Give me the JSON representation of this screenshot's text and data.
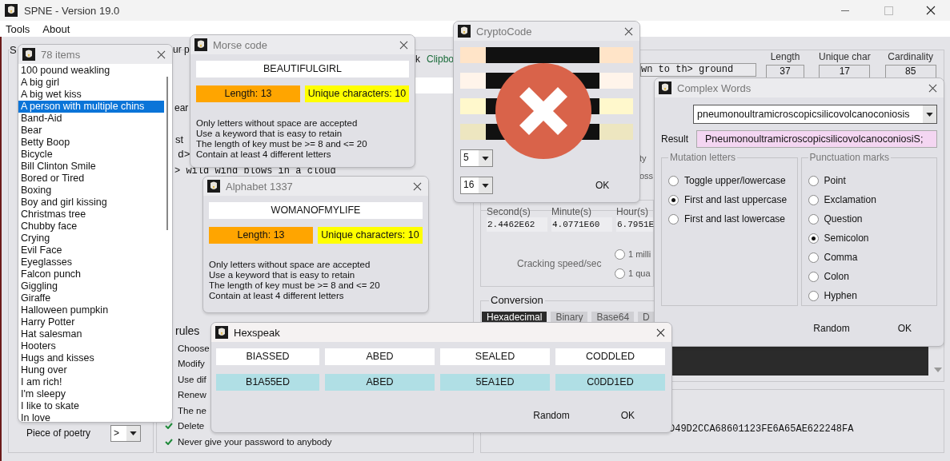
{
  "main_window": {
    "title": "SPNE - Version 19.0",
    "menu": [
      "Tools",
      "About"
    ],
    "password_group": {
      "label": "S",
      "heading_fragment": "ur p",
      "link_fragment": "k",
      "clipboard_link": "Clipbo",
      "button_fragment": "ear",
      "list_label": "st",
      "line_1": "d>",
      "line_2": "> wild wind blows in a cloud"
    },
    "phrase_field": "wn to th> ground",
    "stats": [
      {
        "label": "Length",
        "value": "37"
      },
      {
        "label": "Unique char",
        "value": "17"
      },
      {
        "label": "Cardinality",
        "value": "85"
      }
    ],
    "strength_fragments": [
      "ty",
      "oss"
    ],
    "times": [
      {
        "label": "Second(s)",
        "value": "2.4462E62"
      },
      {
        "label": "Minute(s)",
        "value": "4.0771E60"
      },
      {
        "label": "Hour(s)",
        "value": "6.7951E"
      }
    ],
    "cracking": {
      "label": "Cracking speed/sec",
      "options": [
        {
          "label": "1 milli",
          "selected": false
        },
        {
          "label": "1 qua",
          "selected": false
        }
      ]
    },
    "conversion": {
      "title": "Conversion",
      "tabs": [
        {
          "label": "Hexadecimal",
          "selected": true
        },
        {
          "label": "Binary",
          "selected": false
        },
        {
          "label": "Base64",
          "selected": false
        },
        {
          "label": "D",
          "selected": false
        }
      ],
      "output": "D49D2CCA68601123FE6A65AE622248FA"
    },
    "rules": {
      "title": "rules",
      "items": [
        {
          "text": "Choose"
        },
        {
          "text": "Modify"
        },
        {
          "text": "Use dif"
        },
        {
          "text": "Renew"
        },
        {
          "text": "The ne"
        },
        {
          "text": "Delete",
          "checked": true
        },
        {
          "text": "Never give your password to anybody",
          "checked": true
        }
      ]
    },
    "poetry": {
      "label": "Piece of poetry",
      "value": ">"
    }
  },
  "list_window": {
    "title": "78 items",
    "items": [
      {
        "text": "100 pound weakling",
        "selected": false
      },
      {
        "text": "A big girl",
        "selected": false
      },
      {
        "text": "A big wet kiss",
        "selected": false
      },
      {
        "text": "A person with multiple chins",
        "selected": true
      },
      {
        "text": "Band-Aid",
        "selected": false
      },
      {
        "text": "Bear",
        "selected": false
      },
      {
        "text": "Betty Boop",
        "selected": false
      },
      {
        "text": "Bicycle",
        "selected": false
      },
      {
        "text": "Bill Clinton Smile",
        "selected": false
      },
      {
        "text": "Bored or Tired",
        "selected": false
      },
      {
        "text": "Boxing",
        "selected": false
      },
      {
        "text": "Boy and girl kissing",
        "selected": false
      },
      {
        "text": "Christmas tree",
        "selected": false
      },
      {
        "text": "Chubby face",
        "selected": false
      },
      {
        "text": "Crying",
        "selected": false
      },
      {
        "text": "Evil Face",
        "selected": false
      },
      {
        "text": "Eyeglasses",
        "selected": false
      },
      {
        "text": "Falcon punch",
        "selected": false
      },
      {
        "text": "Giggling",
        "selected": false
      },
      {
        "text": "Giraffe",
        "selected": false
      },
      {
        "text": "Halloween pumpkin",
        "selected": false
      },
      {
        "text": "Harry Potter",
        "selected": false
      },
      {
        "text": "Hat salesman",
        "selected": false
      },
      {
        "text": "Hooters",
        "selected": false
      },
      {
        "text": "Hugs and kisses",
        "selected": false
      },
      {
        "text": "Hung over",
        "selected": false
      },
      {
        "text": "I am rich!",
        "selected": false
      },
      {
        "text": "I'm sleepy",
        "selected": false
      },
      {
        "text": "I like to skate",
        "selected": false
      },
      {
        "text": "In love",
        "selected": false
      }
    ]
  },
  "morse_window": {
    "title": "Morse code",
    "word": "BEAUTIFULGIRL",
    "length": "Length: 13",
    "unique": "Unique characters: 10",
    "notes": [
      "Only letters without space are accepted",
      "Use a keyword that is easy to retain",
      "The length of key must be >= 8 and <= 20",
      "Contain at least 4 different letters"
    ]
  },
  "alphabet_window": {
    "title": "Alphabet 1337",
    "word": "WOMANOFMYLIFE",
    "length": "Length: 13",
    "unique": "Unique characters: 10",
    "notes": [
      "Only letters without space are accepted",
      "Use a keyword that is easy to retain",
      "The length of key must be >= 8 and <= 20",
      "Contain at least 4 different letters"
    ]
  },
  "crypto_window": {
    "title": "CryptoCode",
    "bars": [
      {
        "color": "#ffe4c8"
      },
      {
        "color": "#fff4ea"
      },
      {
        "color": "#fff8cc"
      },
      {
        "color": "#ede6c0"
      }
    ],
    "selects": [
      "5",
      "16"
    ],
    "ok": "OK"
  },
  "complex_window": {
    "title": "Complex Words",
    "word": "pneumonoultramicroscopicsilicovolcanoconiosis",
    "result_label": "Result",
    "result": "PneumonoultramicroscopicsilicovolcanoconiosiS;",
    "mutation": {
      "title": "Mutation letters",
      "options": [
        {
          "label": "Toggle upper/lowercase",
          "selected": false
        },
        {
          "label": "First and last uppercase",
          "selected": true
        },
        {
          "label": "First and last lowercase",
          "selected": false
        }
      ]
    },
    "punctuation": {
      "title": "Punctuation marks",
      "options": [
        {
          "label": "Point",
          "selected": false
        },
        {
          "label": "Exclamation",
          "selected": false
        },
        {
          "label": "Question",
          "selected": false
        },
        {
          "label": "Semicolon",
          "selected": true
        },
        {
          "label": "Comma",
          "selected": false
        },
        {
          "label": "Colon",
          "selected": false
        },
        {
          "label": "Hyphen",
          "selected": false
        }
      ]
    },
    "buttons": [
      "Random",
      "OK"
    ]
  },
  "hexspeak_window": {
    "title": "Hexspeak",
    "pairs": [
      {
        "word": "BIASSED",
        "hex": "B1A55ED"
      },
      {
        "word": "ABED",
        "hex": "ABED"
      },
      {
        "word": "SEALED",
        "hex": "5EA1ED"
      },
      {
        "word": "CODDLED",
        "hex": "C0DD1ED"
      }
    ],
    "buttons": [
      "Random",
      "OK"
    ]
  }
}
